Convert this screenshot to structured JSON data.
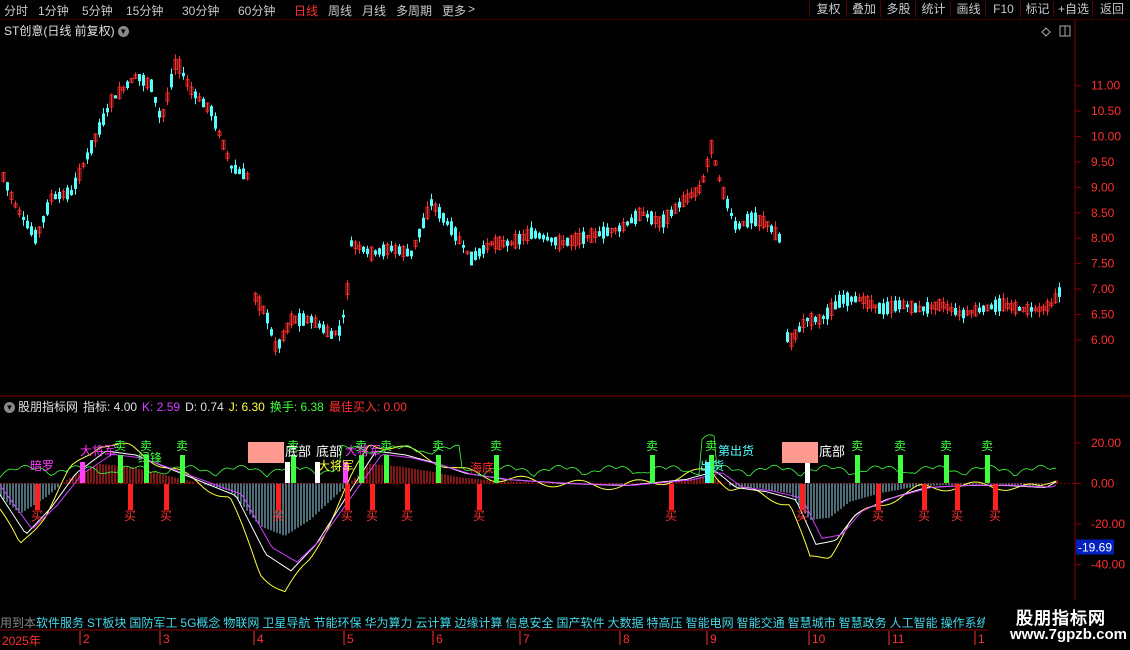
{
  "toolbar": {
    "periods": [
      "分时",
      "1分钟",
      "5分钟",
      "15分钟",
      "30分钟",
      "60分钟",
      "日线",
      "周线",
      "月线",
      "多周期",
      "更多"
    ],
    "active_period": "日线",
    "more_chevron": "chevron-right-icon",
    "right_buttons": [
      "复权",
      "叠加",
      "多股",
      "统计",
      "画线",
      "F10",
      "标记",
      "+自选",
      "返回"
    ]
  },
  "main_chart": {
    "title": "ST创意(日线 前复权)",
    "y_ticks": [
      "11.00",
      "10.50",
      "10.00",
      "9.50",
      "9.00",
      "8.50",
      "8.00",
      "7.50",
      "7.00",
      "6.50",
      "6.00"
    ],
    "y_range": [
      5.25,
      11.9
    ],
    "up_color": "#ff3030",
    "down_color": "#54ffff"
  },
  "indicator": {
    "name": "股朋指标网",
    "values": [
      {
        "label": "指标: 4.00",
        "color": "#e0e0e0"
      },
      {
        "label": "K: 2.59",
        "color": "#d040ff"
      },
      {
        "label": "D: 0.74",
        "color": "#e0e0e0"
      },
      {
        "label": "J: 6.30",
        "color": "#ffff40"
      },
      {
        "label": "换手: 6.38",
        "color": "#40ff40"
      },
      {
        "label": "最佳买入: 0.00",
        "color": "#ff3030"
      }
    ],
    "y_ticks": [
      "20.00",
      "0.00",
      "-20.00",
      "-40.00"
    ],
    "current_value": "-19.69",
    "sell_label": "卖",
    "buy_label": "买",
    "bottom_labels": [
      "底部",
      "底部",
      "底部"
    ],
    "annotations": [
      "暗罗",
      "大将军",
      "绿锋",
      "大将军",
      "海底",
      "大将军",
      "出货",
      "第出货"
    ]
  },
  "sectors": {
    "prefix": "用到本",
    "items": [
      "软件服务",
      "ST板块",
      "国防军工",
      "5G概念",
      "物联网",
      "卫星导航",
      "节能环保",
      "华为算力",
      "云计算",
      "边缘计算",
      "信息安全",
      "国产软件",
      "大数据",
      "特高压",
      "智能电网",
      "智能交通",
      "智慧城市",
      "智慧政务",
      "人工智能",
      "操作系统"
    ]
  },
  "date_axis": {
    "year": "2025年",
    "months": [
      "2",
      "3",
      "4",
      "5",
      "6",
      "7",
      "8",
      "9",
      "10",
      "11",
      "1"
    ]
  },
  "watermark": {
    "title": "股朋指标网",
    "url": "www.7gpzb.com"
  }
}
